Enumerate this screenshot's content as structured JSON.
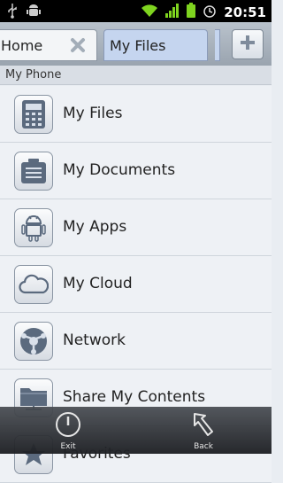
{
  "status_bar": {
    "time": "20:51"
  },
  "tabs": [
    {
      "label": "Home"
    },
    {
      "label": "My Files"
    }
  ],
  "section": {
    "title": "My Phone"
  },
  "list": {
    "items": [
      {
        "label": "My Files",
        "icon": "calculator-icon"
      },
      {
        "label": "My Documents",
        "icon": "document-icon"
      },
      {
        "label": "My Apps",
        "icon": "android-icon"
      },
      {
        "label": "My Cloud",
        "icon": "cloud-icon"
      },
      {
        "label": "Network",
        "icon": "network-icon"
      },
      {
        "label": "Share My Contents",
        "icon": "folder-share-icon"
      },
      {
        "label": "Favorites",
        "icon": "star-icon"
      }
    ]
  },
  "toolbar": {
    "exit_label": "Exit",
    "back_label": "Back"
  },
  "colors": {
    "accent_tab": "#c5d5ef",
    "status_bar": "#000000",
    "battery": "#7fd41f"
  }
}
